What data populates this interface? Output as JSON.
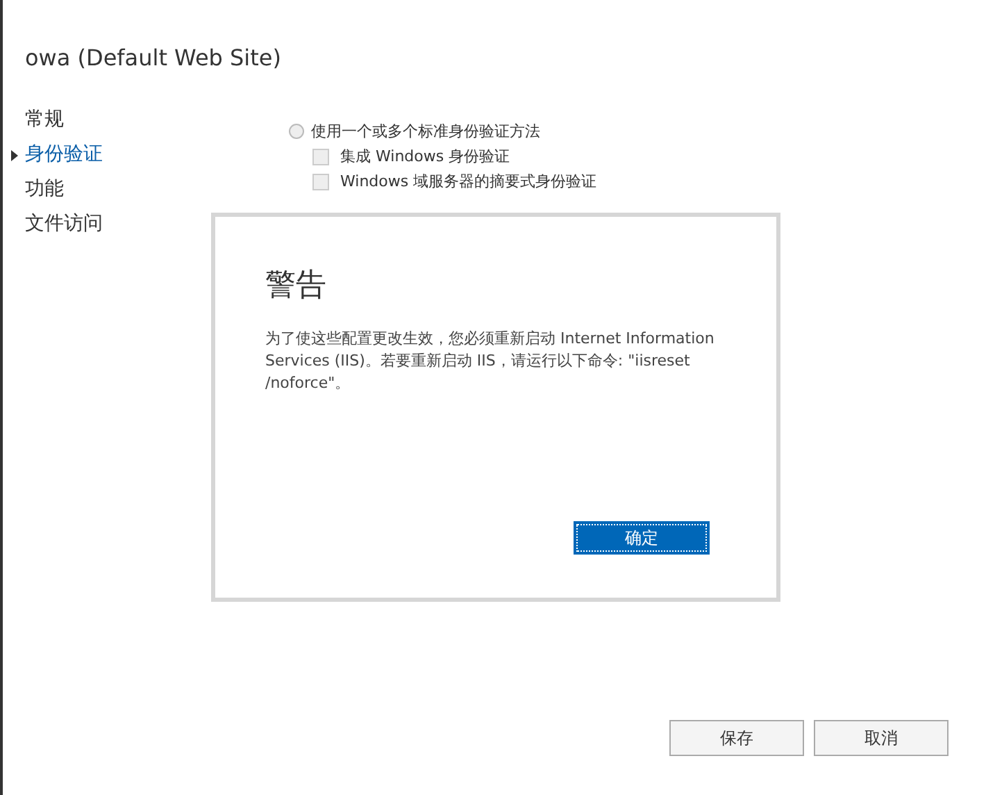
{
  "page": {
    "title": "owa (Default Web Site)"
  },
  "nav": [
    {
      "label": "常规",
      "selected": false
    },
    {
      "label": "身份验证",
      "selected": true
    },
    {
      "label": "功能",
      "selected": false
    },
    {
      "label": "文件访问",
      "selected": false
    }
  ],
  "auth": {
    "radio": {
      "label": "使用一个或多个标准身份验证方法",
      "selected": false
    },
    "checkboxes": [
      {
        "label": "集成 Windows 身份验证",
        "checked": false
      },
      {
        "label": "Windows 域服务器的摘要式身份验证",
        "checked": false
      }
    ]
  },
  "buttons": [
    {
      "label": "保存"
    },
    {
      "label": "取消"
    }
  ],
  "dialog": {
    "title": "警告",
    "message": "为了使这些配置更改生效，您必须重新启动 Internet Information Services (IIS)。若要重新启动 IIS，请运行以下命令: \"iisreset /noforce\"。",
    "button": "确定"
  }
}
